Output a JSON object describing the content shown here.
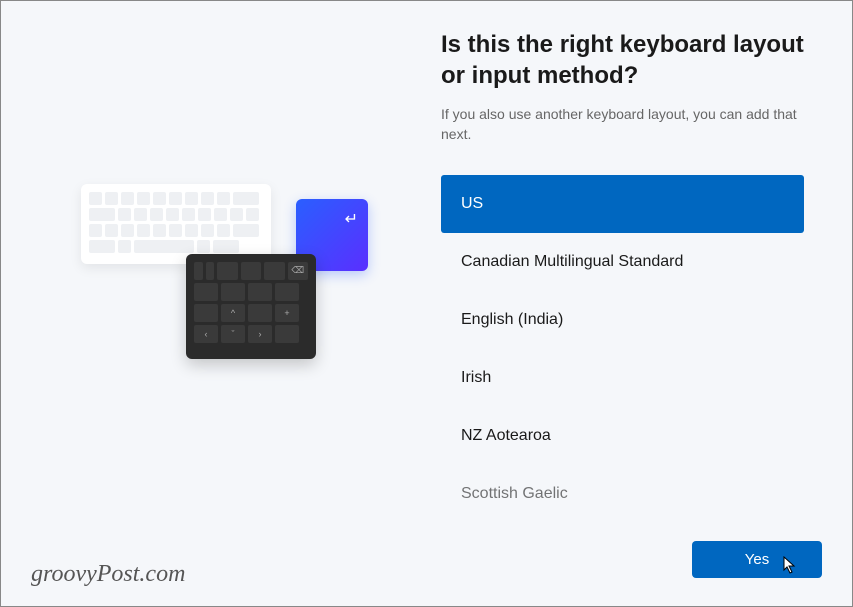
{
  "heading": "Is this the right keyboard layout or input method?",
  "subtext": "If you also use another keyboard layout, you can add that next.",
  "layouts": [
    {
      "label": "US",
      "selected": true
    },
    {
      "label": "Canadian Multilingual Standard",
      "selected": false
    },
    {
      "label": "English (India)",
      "selected": false
    },
    {
      "label": "Irish",
      "selected": false
    },
    {
      "label": "NZ Aotearoa",
      "selected": false
    },
    {
      "label": "Scottish Gaelic",
      "selected": false
    }
  ],
  "buttons": {
    "yes": "Yes"
  },
  "watermark": "groovyPost.com",
  "colors": {
    "accent": "#0067c0"
  }
}
